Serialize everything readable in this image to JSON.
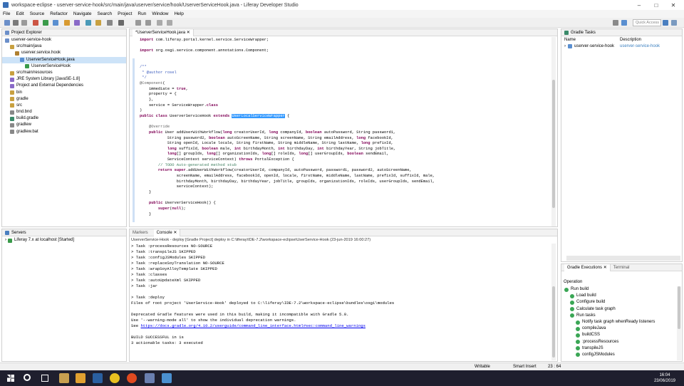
{
  "window": {
    "title": "workspace-eclipse - userver-service-hook/src/main/java/userver/service/hook/UserverServiceHook.java - Liferay Developer Studio"
  },
  "menu": [
    "File",
    "Edit",
    "Source",
    "Refactor",
    "Navigate",
    "Search",
    "Project",
    "Run",
    "Window",
    "Help"
  ],
  "quick_access": "Quick Access",
  "project_explorer": {
    "title": "Project Explorer",
    "items": [
      {
        "label": "userver-service-hook",
        "indent": 0
      },
      {
        "label": "src/main/java",
        "indent": 1
      },
      {
        "label": "userver.service.hook",
        "indent": 2
      },
      {
        "label": "UserverServiceHook.java",
        "indent": 3
      },
      {
        "label": "UserverServiceHook",
        "indent": 4
      },
      {
        "label": "src/main/resources",
        "indent": 1
      },
      {
        "label": "JRE System Library [JavaSE-1.8]",
        "indent": 1
      },
      {
        "label": "Project and External Dependencies",
        "indent": 1
      },
      {
        "label": "bin",
        "indent": 1
      },
      {
        "label": "gradle",
        "indent": 1
      },
      {
        "label": "src",
        "indent": 1
      },
      {
        "label": "bnd.bnd",
        "indent": 1
      },
      {
        "label": "build.gradle",
        "indent": 1
      },
      {
        "label": "gradlew",
        "indent": 1
      },
      {
        "label": "gradlew.bat",
        "indent": 1
      }
    ]
  },
  "servers": {
    "title": "Servers",
    "item": "Liferay 7.x at localhost  [Started]"
  },
  "editor": {
    "tab": "*UserverServiceHook.java"
  },
  "gradle_tasks": {
    "title": "Gradle Tasks",
    "col_name": "Name",
    "col_desc": "Description",
    "row_name": "userver-service-hook",
    "row_desc": "userver-service-hook"
  },
  "gradle_exec": {
    "tab": "Gradle Executions",
    "tab2": "Terminal",
    "header": "Operation",
    "items": [
      {
        "label": "Run build",
        "indent": 0
      },
      {
        "label": "Load build",
        "indent": 1
      },
      {
        "label": "Configure build",
        "indent": 1
      },
      {
        "label": "Calculate task graph",
        "indent": 1
      },
      {
        "label": "Run tasks",
        "indent": 1
      },
      {
        "label": "Notify task graph whenReady listeners",
        "indent": 2
      },
      {
        "label": "compileJava",
        "indent": 2
      },
      {
        "label": "buildCSS",
        "indent": 2
      },
      {
        "label": ":processResources",
        "indent": 2
      },
      {
        "label": "transpileJS",
        "indent": 2
      },
      {
        "label": "configJSModules",
        "indent": 2
      }
    ]
  },
  "console": {
    "tab_markers": "Markers",
    "tab_console": "Console",
    "header": "UserverService-Hook - deploy [Gradle Project] deploy in C:\\liferay\\IDE-7.2\\workspace-eclipse\\UserService-Hook (23-jun-2019 16:00:27)",
    "lines": [
      "> Task :processResources NO-SOURCE",
      "> Task :transpileJS SKIPPED",
      "> Task :configJSModules SKIPPED",
      "> Task :replaceSoyTranslation NO-SOURCE",
      "> Task :wrapSoyAlloyTemplate SKIPPED",
      "> Task :classes",
      "> Task :autoUpdateXml SKIPPED",
      "> Task :jar",
      "",
      "> Task :deploy",
      "Files of root project 'UserService-Hook' deployed to C:\\liferay\\IDE-7.2\\workspace-eclipse\\bundles\\osgi\\modules",
      "",
      "Deprecated Gradle features were used in this build, making it incompatible with Gradle 5.0.",
      "Use '--warning-mode all' to show the individual deprecation warnings.",
      "See ",
      "",
      "BUILD SUCCESSFUL in 1s",
      "3 actionable tasks: 3 executed"
    ],
    "link": "https://docs.gradle.org/4.10.2/userguide/command_line_interface.html#sec:command_line_warnings"
  },
  "status": {
    "writable": "Writable",
    "insert": "Smart Insert",
    "pos": "23 : 64"
  },
  "clock": {
    "time": "16:04",
    "date": "23/06/2019"
  }
}
